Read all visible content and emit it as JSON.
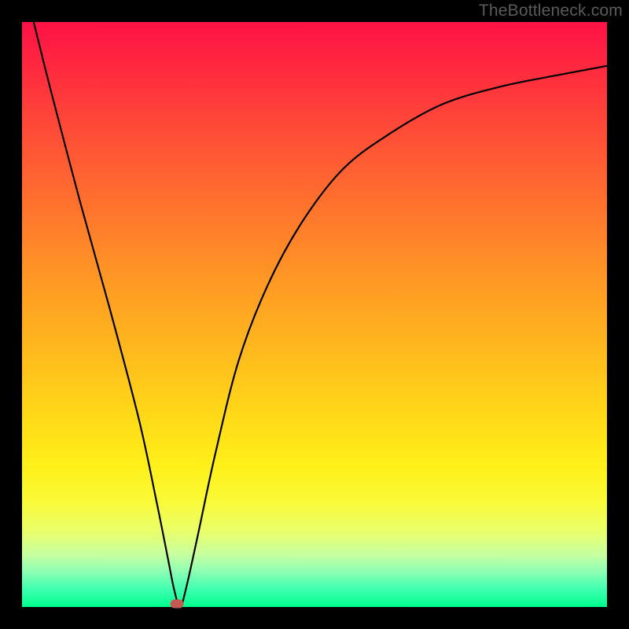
{
  "watermark": "TheBottleneck.com",
  "chart_data": {
    "type": "line",
    "title": "",
    "xlabel": "",
    "ylabel": "",
    "x_range": [
      0,
      100
    ],
    "y_range": [
      0,
      100
    ],
    "series": [
      {
        "name": "curve",
        "x": [
          2,
          5,
          10,
          15,
          20,
          23,
          25,
          26,
          27,
          28,
          30,
          33,
          37,
          42,
          48,
          55,
          63,
          72,
          82,
          92,
          100
        ],
        "y": [
          100,
          88,
          69,
          51,
          32,
          18,
          8,
          3,
          0,
          3,
          12,
          26,
          42,
          55,
          66,
          75,
          81,
          86,
          89,
          91,
          92.5
        ]
      }
    ],
    "marker": {
      "x": 26.5,
      "y": 0.5
    },
    "background": "rainbow-vertical-red-to-green"
  }
}
